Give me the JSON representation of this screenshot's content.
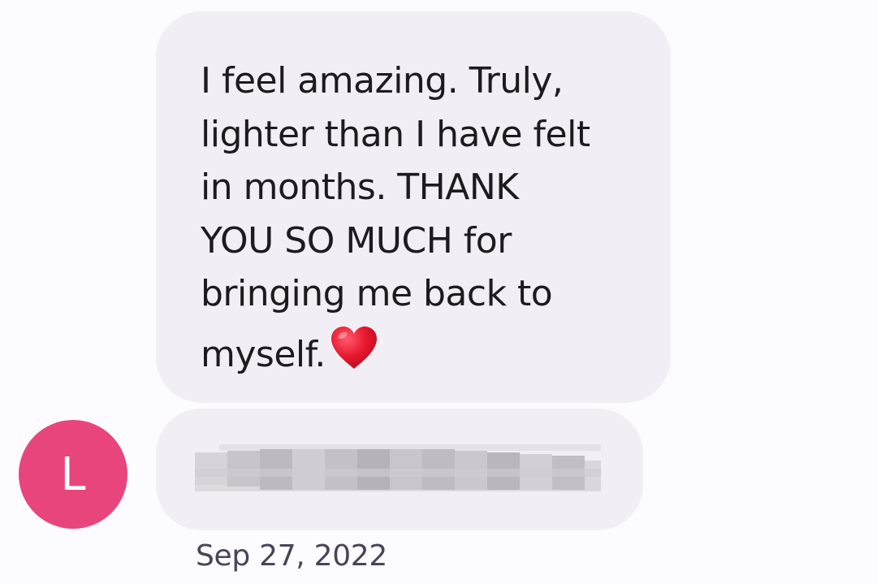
{
  "conversation": {
    "incoming_message": {
      "text": "I feel amazing. Truly,\nlighter than I have felt\nin months. THANK\nYOU SO MUCH for\nbringing me back to\nmyself.",
      "emoji": "heart-emoji"
    },
    "redacted_message": {
      "note": ""
    },
    "sender": {
      "initial": "L",
      "avatar_color": "#e8457d"
    },
    "timestamp": "Sep 27, 2022"
  },
  "colors": {
    "background": "#fcfbff",
    "bubble": "#f1eff5",
    "text": "#1d1b20",
    "heart": "#e8182f"
  }
}
